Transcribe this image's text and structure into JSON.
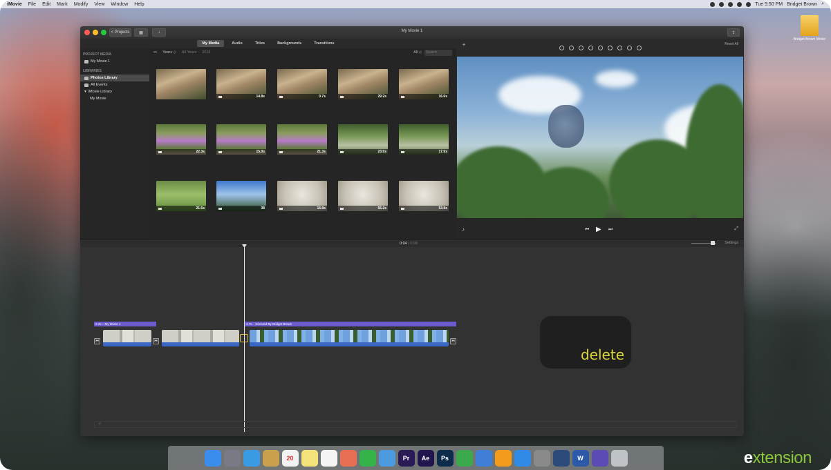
{
  "menubar": {
    "app": "iMovie",
    "menus": [
      "File",
      "Edit",
      "Mark",
      "Modify",
      "View",
      "Window",
      "Help"
    ],
    "clock": "Tue 5:50 PM",
    "user": "Bridget Brown"
  },
  "window": {
    "title": "My Movie 1",
    "projects_button": "< Projects"
  },
  "browser_tabs": [
    "My Media",
    "Audio",
    "Titles",
    "Backgrounds",
    "Transitions"
  ],
  "sidebar": {
    "project_media_header": "PROJECT MEDIA",
    "project": "My Movie 1",
    "libraries_header": "LIBRARIES",
    "items": [
      "Photos Library",
      "All Events",
      "iMovie Library",
      "My Movie"
    ]
  },
  "media_bar": {
    "years": "Years ◇",
    "all_years": "All Years",
    "year": "2016",
    "filter": "All ◇",
    "search_placeholder": "Search"
  },
  "thumbnails": [
    {
      "dur": "",
      "kind": "rock"
    },
    {
      "dur": "14.8s",
      "kind": "rock"
    },
    {
      "dur": "0.7s",
      "kind": "rock"
    },
    {
      "dur": "29.2s",
      "kind": "rock"
    },
    {
      "dur": "16.6s",
      "kind": "rock"
    },
    {
      "dur": "22.3s",
      "kind": "flowers"
    },
    {
      "dur": "15.0s",
      "kind": "flowers"
    },
    {
      "dur": "21.3s",
      "kind": "flowers"
    },
    {
      "dur": "23.5s",
      "kind": "garden"
    },
    {
      "dur": "17.5s",
      "kind": "garden"
    },
    {
      "dur": "21.5s",
      "kind": "lawn"
    },
    {
      "dur": "38",
      "kind": "sky"
    },
    {
      "dur": "16.8s",
      "kind": "water"
    },
    {
      "dur": "56.2s",
      "kind": "water"
    },
    {
      "dur": "53.9s",
      "kind": "water"
    }
  ],
  "viewer": {
    "reset_all": "Reset All"
  },
  "timeline": {
    "current": "0:04",
    "total": "/ 0:09",
    "settings": "Settings",
    "title_clip_1": "2.2s – My Movie 1",
    "title_clip_2": "4.7s – Directed By Bridget Brown"
  },
  "overlay": {
    "text": "delete"
  },
  "desktop_file": {
    "label": "Bridget Brown Movie"
  },
  "brand": {
    "lead": "e",
    "rest": "xtension"
  },
  "dock": [
    {
      "label": "Finder",
      "color": "#3b8ded"
    },
    {
      "label": "Launchpad",
      "color": "#7a7a86"
    },
    {
      "label": "Safari",
      "color": "#3a9be5"
    },
    {
      "label": "Notes",
      "color": "#c9a04b"
    },
    {
      "label": "20",
      "color": "#f2f2f2"
    },
    {
      "label": "Stickies",
      "color": "#f6e27a"
    },
    {
      "label": "Reminders",
      "color": "#f4f4f4"
    },
    {
      "label": "Photos",
      "color": "#e96f53"
    },
    {
      "label": "FaceTime",
      "color": "#35b24a"
    },
    {
      "label": "Messages",
      "color": "#4c9be0"
    },
    {
      "label": "Pr",
      "color": "#2a1b57"
    },
    {
      "label": "Ae",
      "color": "#20164d"
    },
    {
      "label": "Ps",
      "color": "#0d2b4a"
    },
    {
      "label": "Numbers",
      "color": "#3ba84b"
    },
    {
      "label": "Keynote",
      "color": "#3f7fd7"
    },
    {
      "label": "iBooks",
      "color": "#f39c1c"
    },
    {
      "label": "App Store",
      "color": "#2f8be6"
    },
    {
      "label": "System Preferences",
      "color": "#8a8a8a"
    },
    {
      "label": "QuickTime",
      "color": "#2c4a7a"
    },
    {
      "label": "W",
      "color": "#2c5aa8"
    },
    {
      "label": "iMovie",
      "color": "#5b4bb2"
    },
    {
      "label": "Trash",
      "color": "#bfc2c7"
    }
  ]
}
